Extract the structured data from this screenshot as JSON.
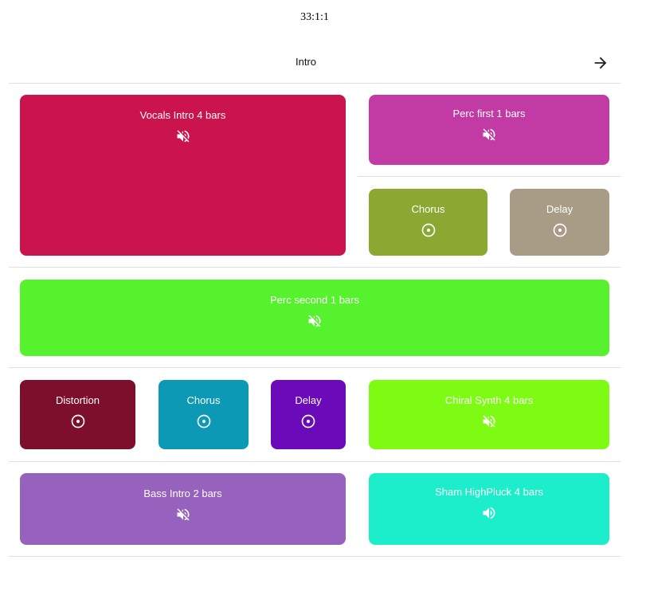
{
  "header": {
    "counter": "33:1:1",
    "section_title": "Intro",
    "next_icon": "arrow-right-icon"
  },
  "pads": {
    "vocals_intro": {
      "label": "Vocals Intro 4 bars",
      "color": "#cb134e",
      "state": "muted",
      "icon": "volume-off-icon"
    },
    "perc_first": {
      "label": "Perc first 1 bars",
      "color": "#c23aa3",
      "state": "muted",
      "icon": "volume-off-icon"
    },
    "chorus_top": {
      "label": "Chorus",
      "color": "#8ba833",
      "state": "effect",
      "icon": "disc-icon"
    },
    "delay_top": {
      "label": "Delay",
      "color": "#a99c87",
      "state": "effect",
      "icon": "disc-icon"
    },
    "perc_second": {
      "label": "Perc second 1 bars",
      "color": "#56f22d",
      "state": "muted",
      "icon": "volume-off-icon"
    },
    "distortion": {
      "label": "Distortion",
      "color": "#7e0f2c",
      "state": "effect",
      "icon": "disc-icon"
    },
    "chorus_bottom": {
      "label": "Chorus",
      "color": "#0b99b6",
      "state": "effect",
      "icon": "disc-icon"
    },
    "delay_bottom": {
      "label": "Delay",
      "color": "#6a0ab9",
      "state": "effect",
      "icon": "disc-icon"
    },
    "chiral_synth": {
      "label": "Chiral Synth 4 bars",
      "color": "#7dfb13",
      "state": "muted",
      "icon": "volume-off-icon"
    },
    "bass_intro": {
      "label": "Bass Intro 2 bars",
      "color": "#9761be",
      "state": "muted",
      "icon": "volume-off-icon"
    },
    "sham_highpluck": {
      "label": "Sham HighPluck 4 bars",
      "color": "#1ceecb",
      "state": "playing",
      "icon": "volume-up-icon"
    }
  }
}
